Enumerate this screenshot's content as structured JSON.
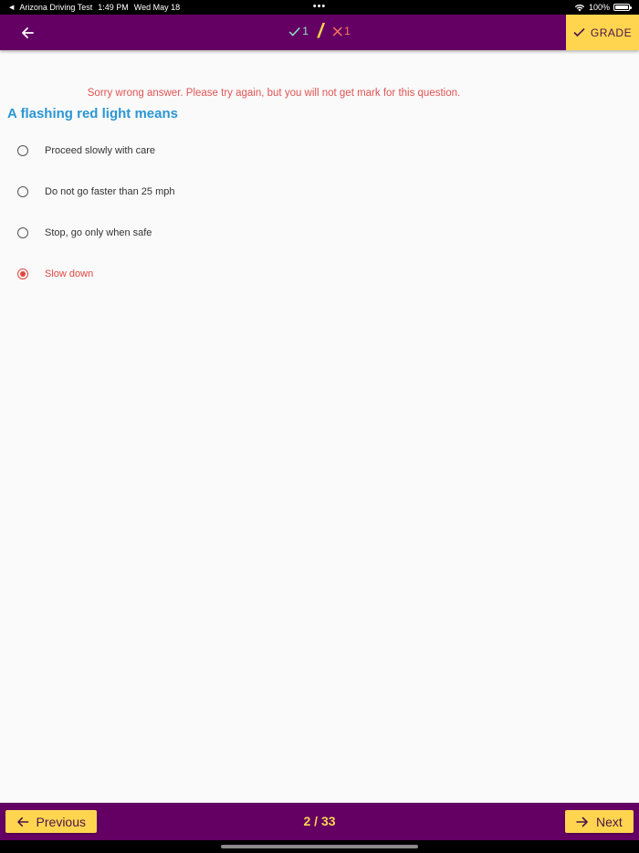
{
  "status_bar": {
    "app_back": "Arizona Driving Test",
    "time": "1:49 PM",
    "date": "Wed May 18",
    "dots": "•••",
    "battery": "100%"
  },
  "header": {
    "correct_count": "1",
    "wrong_count": "1",
    "separator": "/",
    "grade_label": "GRADE"
  },
  "quiz": {
    "feedback": "Sorry wrong answer. Please try again, but you will not get mark for this question.",
    "question": "A flashing red light means",
    "options": [
      {
        "label": "Proceed slowly with care",
        "selected": false
      },
      {
        "label": "Do not go faster than 25 mph",
        "selected": false
      },
      {
        "label": "Stop, go only when safe",
        "selected": false
      },
      {
        "label": "Slow down",
        "selected": true
      }
    ]
  },
  "footer": {
    "previous_label": "Previous",
    "page_indicator": "2 / 33",
    "next_label": "Next"
  },
  "colors": {
    "app_bar": "#640064",
    "accent_yellow": "#ffd54f",
    "error_red": "#e05353",
    "question_blue": "#2b96d3",
    "correct_green": "#8ee3c8",
    "wrong_orange": "#ff7a59"
  }
}
